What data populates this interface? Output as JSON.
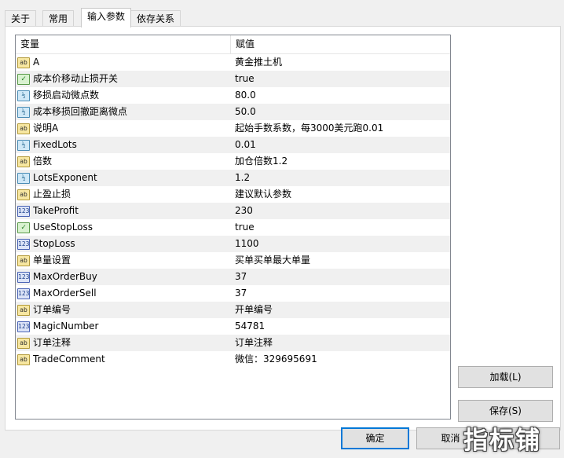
{
  "tabs": [
    "关于",
    "常用",
    "输入参数",
    "依存关系"
  ],
  "table": {
    "headers": [
      "变量",
      "赋值"
    ],
    "rows": [
      {
        "type": "str",
        "icon": "string-type-icon",
        "name": "A",
        "value": "黄金推土机"
      },
      {
        "type": "bool",
        "icon": "boolean-type-icon",
        "name": "成本价移动止损开关",
        "value": "true"
      },
      {
        "type": "dbl",
        "icon": "double-type-icon",
        "name": "移损启动微点数",
        "value": "80.0"
      },
      {
        "type": "dbl",
        "icon": "double-type-icon",
        "name": "成本移损回撤距离微点",
        "value": "50.0"
      },
      {
        "type": "str",
        "icon": "string-type-icon",
        "name": "说明A",
        "value": "起始手数系数，每3000美元跑0.01"
      },
      {
        "type": "dbl",
        "icon": "double-type-icon",
        "name": "FixedLots",
        "value": "0.01"
      },
      {
        "type": "str",
        "icon": "string-type-icon",
        "name": "倍数",
        "value": "加仓倍数1.2"
      },
      {
        "type": "dbl",
        "icon": "double-type-icon",
        "name": "LotsExponent",
        "value": "1.2"
      },
      {
        "type": "str",
        "icon": "string-type-icon",
        "name": "止盈止损",
        "value": "建议默认参数"
      },
      {
        "type": "int",
        "icon": "integer-type-icon",
        "name": "TakeProfit",
        "value": "230"
      },
      {
        "type": "bool",
        "icon": "boolean-type-icon",
        "name": "UseStopLoss",
        "value": "true"
      },
      {
        "type": "int",
        "icon": "integer-type-icon",
        "name": "StopLoss",
        "value": "1100"
      },
      {
        "type": "str",
        "icon": "string-type-icon",
        "name": "单量设置",
        "value": "买单买单最大单量"
      },
      {
        "type": "int",
        "icon": "integer-type-icon",
        "name": "MaxOrderBuy",
        "value": "37"
      },
      {
        "type": "int",
        "icon": "integer-type-icon",
        "name": "MaxOrderSell",
        "value": "37"
      },
      {
        "type": "str",
        "icon": "string-type-icon",
        "name": "订单编号",
        "value": "开单编号"
      },
      {
        "type": "int",
        "icon": "integer-type-icon",
        "name": "MagicNumber",
        "value": "54781"
      },
      {
        "type": "str",
        "icon": "string-type-icon",
        "name": "订单注释",
        "value": "订单注释"
      },
      {
        "type": "str",
        "icon": "string-type-icon",
        "name": "TradeComment",
        "value": "微信：329695691"
      }
    ]
  },
  "icon_glyphs": {
    "str": "ab",
    "bool": "✓",
    "dbl": "½",
    "int": "123"
  },
  "buttons": {
    "load": "加载(L)",
    "save": "保存(S)",
    "ok": "确定",
    "cancel": "取消",
    "reset": "重置"
  },
  "watermark": "指标铺"
}
